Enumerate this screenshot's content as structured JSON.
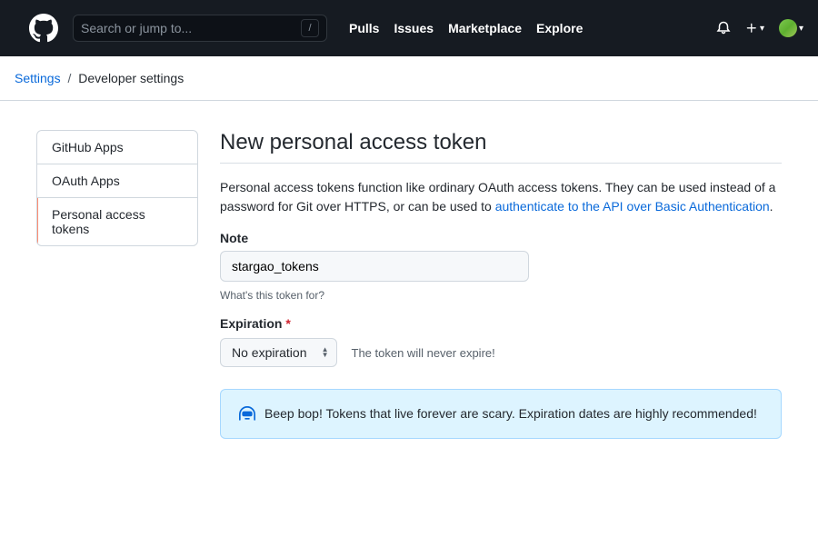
{
  "header": {
    "search_placeholder": "Search or jump to...",
    "slash": "/",
    "links": [
      "Pulls",
      "Issues",
      "Marketplace",
      "Explore"
    ]
  },
  "breadcrumb": {
    "settings": "Settings",
    "sep": "/",
    "current": "Developer settings"
  },
  "sidebar": {
    "items": [
      {
        "label": "GitHub Apps"
      },
      {
        "label": "OAuth Apps"
      },
      {
        "label": "Personal access tokens"
      }
    ]
  },
  "main": {
    "title": "New personal access token",
    "description_pre": "Personal access tokens function like ordinary OAuth access tokens. They can be used instead of a password for Git over HTTPS, or can be used to ",
    "description_link": "authenticate to the API over Basic Authentication",
    "description_post": ".",
    "note_label": "Note",
    "note_value": "stargao_tokens",
    "note_help": "What's this token for?",
    "expiration_label": "Expiration",
    "required": "*",
    "expiration_selected": "No expiration",
    "expiration_hint": "The token will never expire!",
    "flash_text": "Beep bop! Tokens that live forever are scary. Expiration dates are highly recommended!"
  }
}
